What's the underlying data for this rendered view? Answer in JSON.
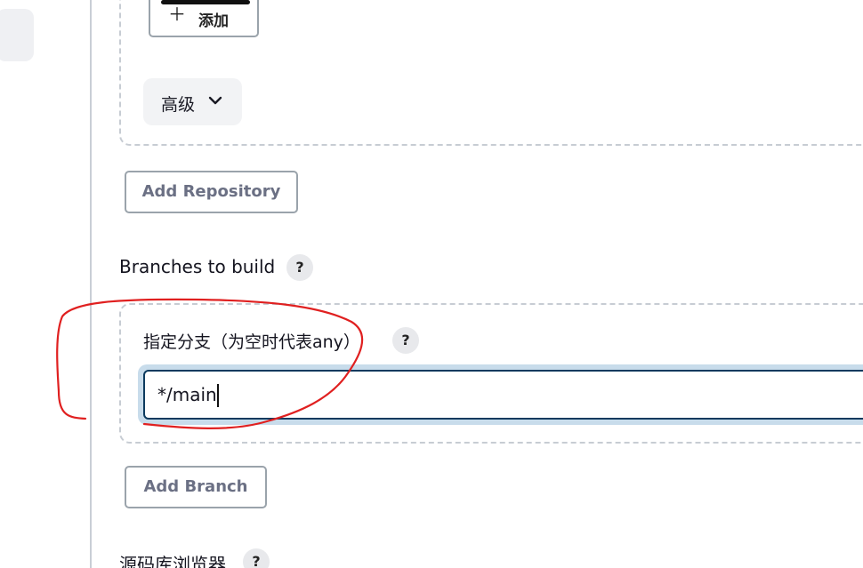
{
  "repository": {
    "add_label": "添加",
    "add_icon": "plus-icon",
    "advanced_label": "高级",
    "advanced_icon": "chevron-down-icon",
    "add_repository_label": "Add Repository"
  },
  "branches": {
    "section_label": "Branches to build",
    "help_label": "?",
    "spec_label": "指定分支（为空时代表any）",
    "spec_help_label": "?",
    "spec_value": "*/main",
    "add_branch_label": "Add Branch"
  },
  "repository_browser": {
    "section_label": "源码库浏览器",
    "help_label": "?"
  },
  "colors": {
    "annotation": "#e02020",
    "input_border": "#0c3a5e",
    "input_focus_ring": "#c8dceb"
  }
}
